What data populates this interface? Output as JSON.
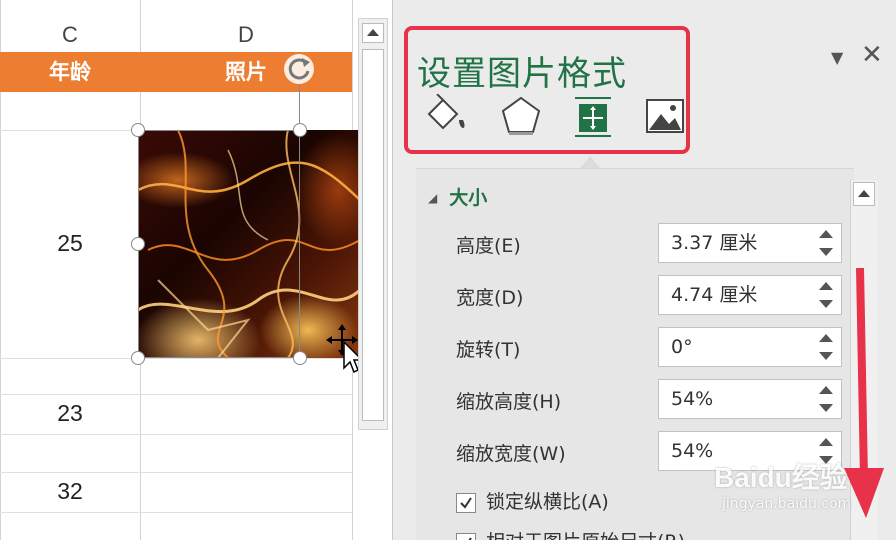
{
  "sheet": {
    "columns": [
      "C",
      "D"
    ],
    "header_cells": [
      "年龄",
      "照片"
    ],
    "rows": [
      {
        "age": "25"
      },
      {
        "age": "23"
      },
      {
        "age": "32"
      }
    ]
  },
  "format_pane": {
    "title": "设置图片格式",
    "tabs": [
      {
        "name": "fill-line",
        "icon": "paint-bucket-icon"
      },
      {
        "name": "effects",
        "icon": "pentagon-icon"
      },
      {
        "name": "size-properties",
        "icon": "size-position-icon"
      },
      {
        "name": "picture",
        "icon": "picture-icon"
      }
    ],
    "section_title": "大小",
    "properties": [
      {
        "label": "高度(E)",
        "value": "3.37 厘米"
      },
      {
        "label": "宽度(D)",
        "value": "4.74 厘米"
      },
      {
        "label": "旋转(T)",
        "value": "0°"
      },
      {
        "label": "缩放高度(H)",
        "value": "54%"
      },
      {
        "label": "缩放宽度(W)",
        "value": "54%"
      }
    ],
    "checkboxes": [
      {
        "label": "锁定纵横比(A)",
        "checked": true
      },
      {
        "label": "相对于图片原始尺寸(R)",
        "checked": true
      }
    ]
  },
  "watermark": {
    "brand": "Baidu经验",
    "url": "jingyan.baidu.com"
  },
  "colors": {
    "header_orange": "#ed7d31",
    "accent_green": "#217346",
    "highlight_red": "#e8324a"
  }
}
